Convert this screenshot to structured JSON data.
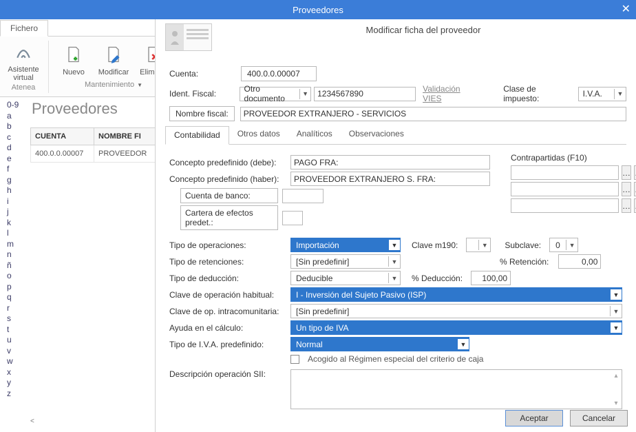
{
  "window": {
    "title": "Proveedores"
  },
  "ribbon": {
    "tab": "Fichero",
    "assistant": "Asistente\nvirtual",
    "assistant_brand": "Atenea",
    "new": "Nuevo",
    "modify": "Modificar",
    "delete": "Eliminar",
    "group_maintenance": "Mantenimiento"
  },
  "list": {
    "title": "Proveedores",
    "cols": {
      "account": "CUENTA",
      "name": "NOMBRE FI"
    },
    "rows": [
      {
        "account": "400.0.0.00007",
        "name": "PROVEEDOR"
      }
    ]
  },
  "alpha": [
    "0-9",
    "a",
    "b",
    "c",
    "d",
    "e",
    "f",
    "g",
    "h",
    "i",
    "j",
    "k",
    "l",
    "m",
    "n",
    "ñ",
    "o",
    "p",
    "q",
    "r",
    "s",
    "t",
    "u",
    "v",
    "w",
    "x",
    "y",
    "z"
  ],
  "dialog": {
    "title": "Modificar ficha del proveedor",
    "cuenta_label": "Cuenta:",
    "cuenta_value": "400.0.0.00007",
    "ident_label": "Ident. Fiscal:",
    "ident_type": "Otro documento",
    "ident_value": "1234567890",
    "vies": "Validación VIES",
    "clase_label": "Clase de impuesto:",
    "clase_value": "I.V.A.",
    "nombre_label": "Nombre fiscal:",
    "nombre_value": "PROVEEDOR EXTRANJERO - SERVICIOS",
    "tabs": [
      "Contabilidad",
      "Otros datos",
      "Analíticos",
      "Observaciones"
    ],
    "concepto_debe_label": "Concepto predefinido (debe):",
    "concepto_debe_value": "PAGO FRA:",
    "concepto_haber_label": "Concepto predefinido (haber):",
    "concepto_haber_value": "PROVEEDOR EXTRANJERO S. FRA:",
    "cuenta_banco_label": "Cuenta de banco:",
    "cartera_label": "Cartera de efectos predet.:",
    "contrapartidas_label": "Contrapartidas (F10)",
    "tipo_op_label": "Tipo de operaciones:",
    "tipo_op_value": "Importación",
    "clave_m190_label": "Clave m190:",
    "subclave_label": "Subclave:",
    "subclave_value": "0",
    "tipo_ret_label": "Tipo de retenciones:",
    "tipo_ret_value": "[Sin predefinir]",
    "pct_ret_label": "% Retención:",
    "pct_ret_value": "0,00",
    "tipo_ded_label": "Tipo de deducción:",
    "tipo_ded_value": "Deducible",
    "pct_ded_label": "% Deducción:",
    "pct_ded_value": "100,00",
    "clave_op_label": "Clave de operación habitual:",
    "clave_op_value": "I - Inversión del Sujeto Pasivo (ISP)",
    "clave_intra_label": "Clave de op. intracomunitaria:",
    "clave_intra_value": "[Sin predefinir]",
    "ayuda_label": "Ayuda en el cálculo:",
    "ayuda_value": "Un tipo de IVA",
    "iva_label": "Tipo de I.V.A. predefinido:",
    "iva_value": "Normal",
    "acogido_label": "Acogido al Régimen especial del criterio de caja",
    "desc_sii_label": "Descripción operación SII:",
    "accept": "Aceptar",
    "cancel": "Cancelar"
  }
}
